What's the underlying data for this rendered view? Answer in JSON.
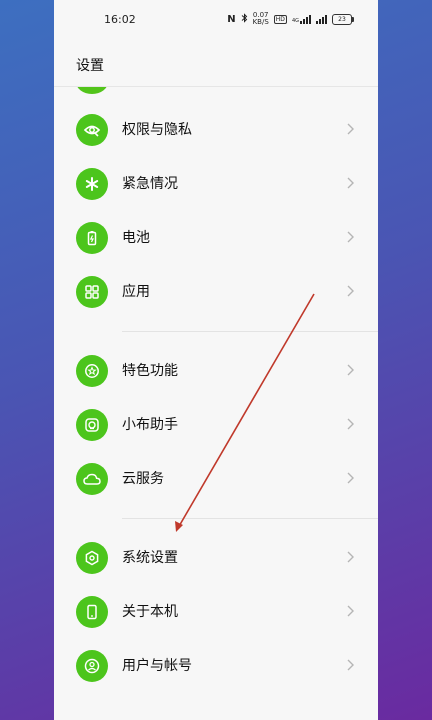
{
  "status_bar": {
    "time": "16:02",
    "nfc": "N",
    "network_speed_value": "0.07",
    "network_speed_unit": "KB/S",
    "hd_badge": "HD",
    "signal_label": "4G",
    "battery_level": "23"
  },
  "header": {
    "title": "设置"
  },
  "menu": {
    "items": [
      {
        "label": "权限与隐私",
        "icon": "privacy-eye-icon"
      },
      {
        "label": "紧急情况",
        "icon": "emergency-asterisk-icon"
      },
      {
        "label": "电池",
        "icon": "battery-icon"
      },
      {
        "label": "应用",
        "icon": "apps-grid-icon"
      },
      {
        "label": "特色功能",
        "icon": "star-badge-icon"
      },
      {
        "label": "小布助手",
        "icon": "assistant-icon"
      },
      {
        "label": "云服务",
        "icon": "cloud-icon"
      },
      {
        "label": "系统设置",
        "icon": "hexagon-settings-icon"
      },
      {
        "label": "关于本机",
        "icon": "phone-device-icon"
      },
      {
        "label": "用户与帐号",
        "icon": "user-account-icon"
      }
    ]
  },
  "colors": {
    "icon_green": "#4cc51c",
    "annotation_arrow": "#c0392b"
  }
}
